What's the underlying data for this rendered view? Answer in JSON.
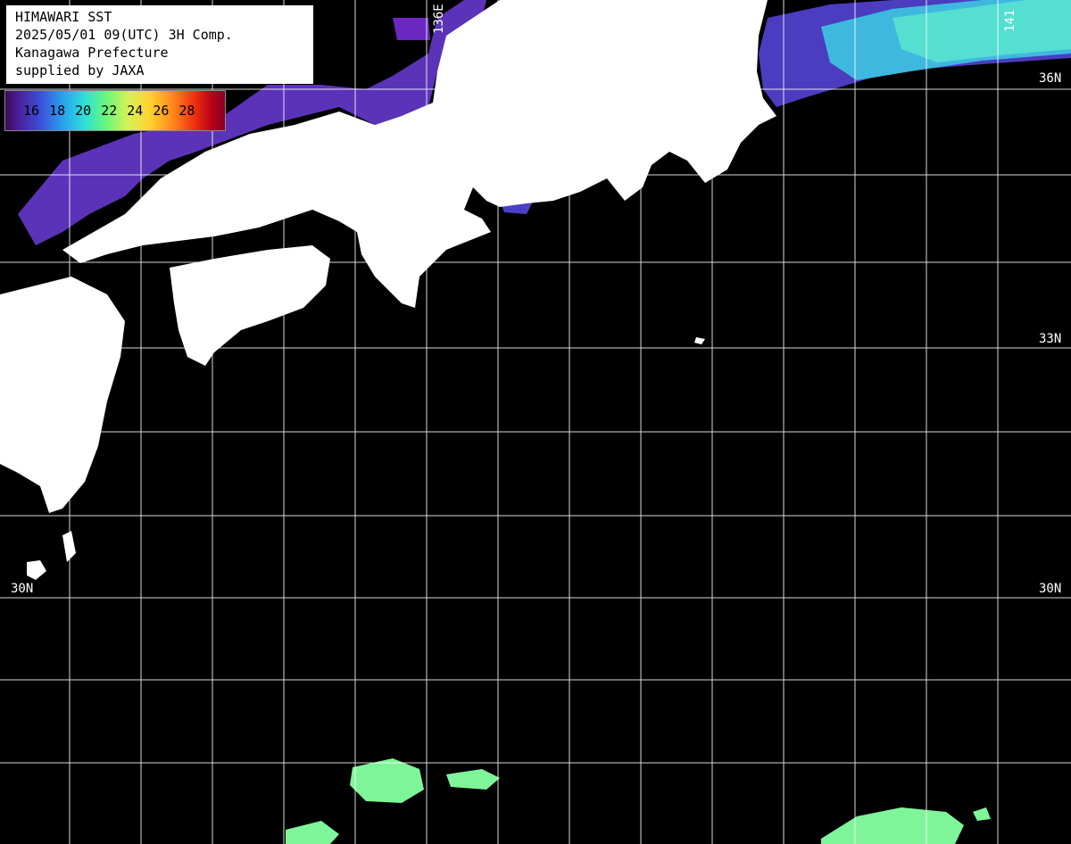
{
  "header": {
    "line1": "HIMAWARI SST",
    "line2": "2025/05/01 09(UTC) 3H Comp.",
    "line3": "Kanagawa Prefecture",
    "line4": "supplied by JAXA"
  },
  "scale": {
    "ticks": [
      "16",
      "18",
      "20",
      "22",
      "24",
      "26",
      "28"
    ]
  },
  "labels": {
    "lat_36": "36N",
    "lat_33": "33N",
    "lat_33_left": "33",
    "lat_30_left": "30N",
    "lat_30_right": "30N",
    "lon_136": "136E",
    "lon_141": "141"
  },
  "colors": {
    "land": "#ffffff",
    "ocean_nodata": "#000000",
    "grid": "#ffffff",
    "sst_cold": "#5a2fb0",
    "sst_cool": "#2fd0d8",
    "sst_mild": "#7ff59a"
  }
}
